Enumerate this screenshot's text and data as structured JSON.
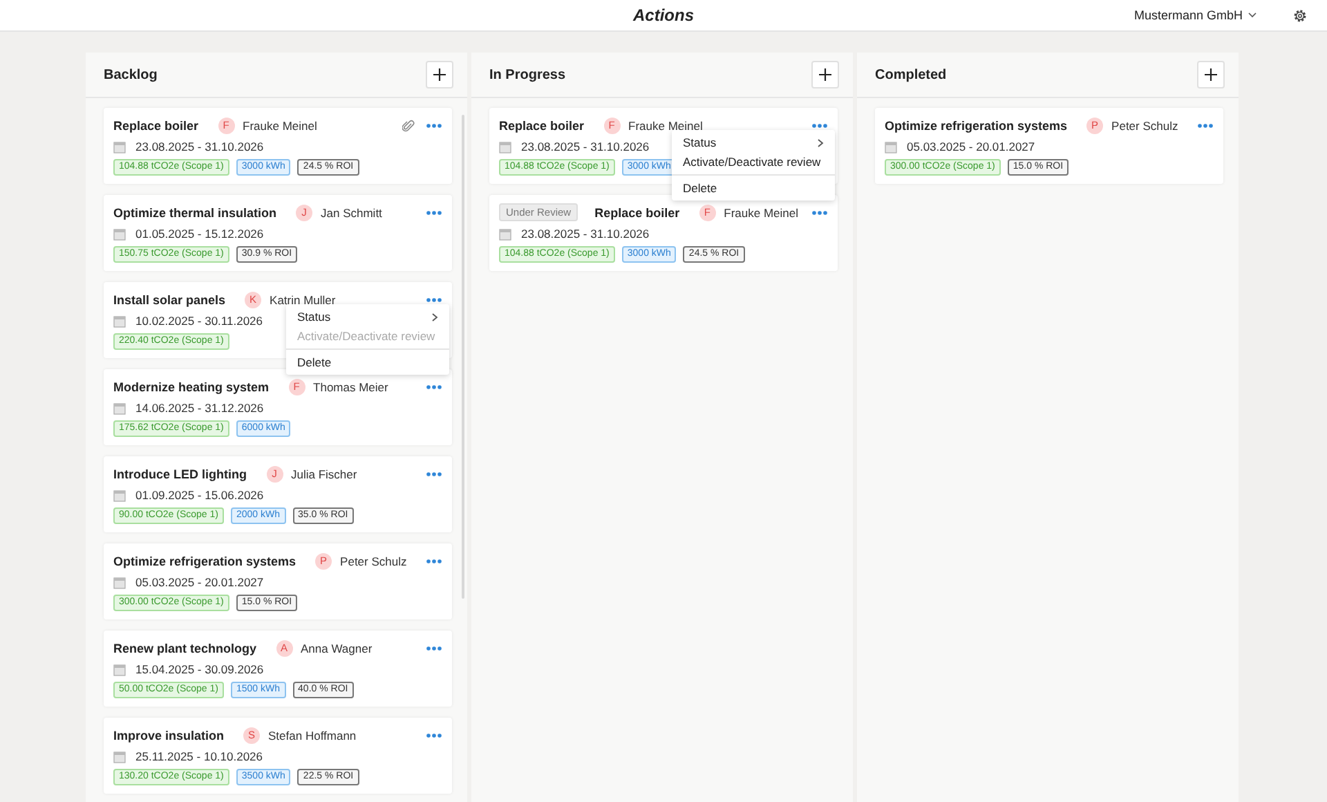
{
  "header": {
    "title": "Actions",
    "company": "Mustermann GmbH"
  },
  "columns": [
    {
      "title": "Backlog",
      "scrollbar": true,
      "cards": [
        {
          "title": "Replace boiler",
          "initial": "F",
          "assignee": "Frauke Meinel",
          "edit_icon": true,
          "dates": "23.08.2025 - 31.10.2026",
          "tags": [
            {
              "kind": "co2",
              "text": "104.88 tCO2e (Scope 1)"
            },
            {
              "kind": "energy",
              "text": "3000 kWh"
            },
            {
              "kind": "roi",
              "text": "24.5 % ROI"
            }
          ]
        },
        {
          "title": "Optimize thermal insulation",
          "initial": "J",
          "assignee": "Jan Schmitt",
          "edit_icon": false,
          "dates": "01.05.2025 - 15.12.2026",
          "tags": [
            {
              "kind": "co2",
              "text": "150.75 tCO2e (Scope 1)"
            },
            {
              "kind": "roi",
              "text": "30.9 % ROI"
            }
          ]
        },
        {
          "title": "Install solar panels",
          "initial": "K",
          "assignee": "Katrin Muller",
          "edit_icon": false,
          "dates": "10.02.2025 - 30.11.2026",
          "tags": [
            {
              "kind": "co2",
              "text": "220.40 tCO2e (Scope 1)"
            }
          ],
          "menu": [
            {
              "kind": "submenu",
              "label": "Status",
              "disabled": false
            },
            {
              "kind": "action",
              "label": "Activate/Deactivate review",
              "disabled": true
            },
            {
              "kind": "separator"
            },
            {
              "kind": "action",
              "label": "Delete",
              "disabled": false
            }
          ]
        },
        {
          "title": "Modernize heating system",
          "initial": "F",
          "assignee": "Thomas Meier",
          "edit_icon": false,
          "dates": "14.06.2025 - 31.12.2026",
          "tags": [
            {
              "kind": "co2",
              "text": "175.62 tCO2e (Scope 1)"
            },
            {
              "kind": "energy",
              "text": "6000 kWh"
            }
          ]
        },
        {
          "title": "Introduce LED lighting",
          "initial": "J",
          "assignee": "Julia Fischer",
          "edit_icon": false,
          "dates": "01.09.2025 - 15.06.2026",
          "tags": [
            {
              "kind": "co2",
              "text": "90.00 tCO2e (Scope 1)"
            },
            {
              "kind": "energy",
              "text": "2000 kWh"
            },
            {
              "kind": "roi",
              "text": "35.0 % ROI"
            }
          ]
        },
        {
          "title": "Optimize refrigeration systems",
          "initial": "P",
          "assignee": "Peter Schulz",
          "edit_icon": false,
          "dates": "05.03.2025 - 20.01.2027",
          "tags": [
            {
              "kind": "co2",
              "text": "300.00 tCO2e (Scope 1)"
            },
            {
              "kind": "roi",
              "text": "15.0 % ROI"
            }
          ]
        },
        {
          "title": "Renew plant technology",
          "initial": "A",
          "assignee": "Anna Wagner",
          "edit_icon": false,
          "dates": "15.04.2025 - 30.09.2026",
          "tags": [
            {
              "kind": "co2",
              "text": "50.00 tCO2e (Scope 1)"
            },
            {
              "kind": "energy",
              "text": "1500 kWh"
            },
            {
              "kind": "roi",
              "text": "40.0 % ROI"
            }
          ]
        },
        {
          "title": "Improve insulation",
          "initial": "S",
          "assignee": "Stefan Hoffmann",
          "edit_icon": false,
          "dates": "25.11.2025 - 10.10.2026",
          "tags": [
            {
              "kind": "co2",
              "text": "130.20 tCO2e (Scope 1)"
            },
            {
              "kind": "energy",
              "text": "3500 kWh"
            },
            {
              "kind": "roi",
              "text": "22.5 % ROI"
            }
          ]
        }
      ]
    },
    {
      "title": "In Progress",
      "scrollbar": false,
      "cards": [
        {
          "title": "Replace boiler",
          "initial": "F",
          "assignee": "Frauke Meinel",
          "edit_icon": false,
          "dates": "23.08.2025 - 31.10.2026",
          "tags": [
            {
              "kind": "co2",
              "text": "104.88 tCO2e (Scope 1)"
            },
            {
              "kind": "energy",
              "text": "3000 kWh"
            }
          ],
          "menu": [
            {
              "kind": "submenu",
              "label": "Status",
              "disabled": false
            },
            {
              "kind": "action",
              "label": "Activate/Deactivate review",
              "disabled": false
            },
            {
              "kind": "separator"
            },
            {
              "kind": "action",
              "label": "Delete",
              "disabled": false
            }
          ]
        },
        {
          "badge": "Under Review",
          "title": "Replace boiler",
          "initial": "F",
          "assignee": "Frauke Meinel",
          "edit_icon": false,
          "dates": "23.08.2025 - 31.10.2026",
          "tags": [
            {
              "kind": "co2",
              "text": "104.88 tCO2e (Scope 1)"
            },
            {
              "kind": "energy",
              "text": "3000 kWh"
            },
            {
              "kind": "roi",
              "text": "24.5 % ROI"
            }
          ]
        }
      ]
    },
    {
      "title": "Completed",
      "scrollbar": false,
      "cards": [
        {
          "title": "Optimize refrigeration systems",
          "initial": "P",
          "assignee": "Peter Schulz",
          "edit_icon": false,
          "dates": "05.03.2025 - 20.01.2027",
          "tags": [
            {
              "kind": "co2",
              "text": "300.00 tCO2e (Scope 1)"
            },
            {
              "kind": "roi",
              "text": "15.0 % ROI"
            }
          ]
        }
      ]
    }
  ]
}
